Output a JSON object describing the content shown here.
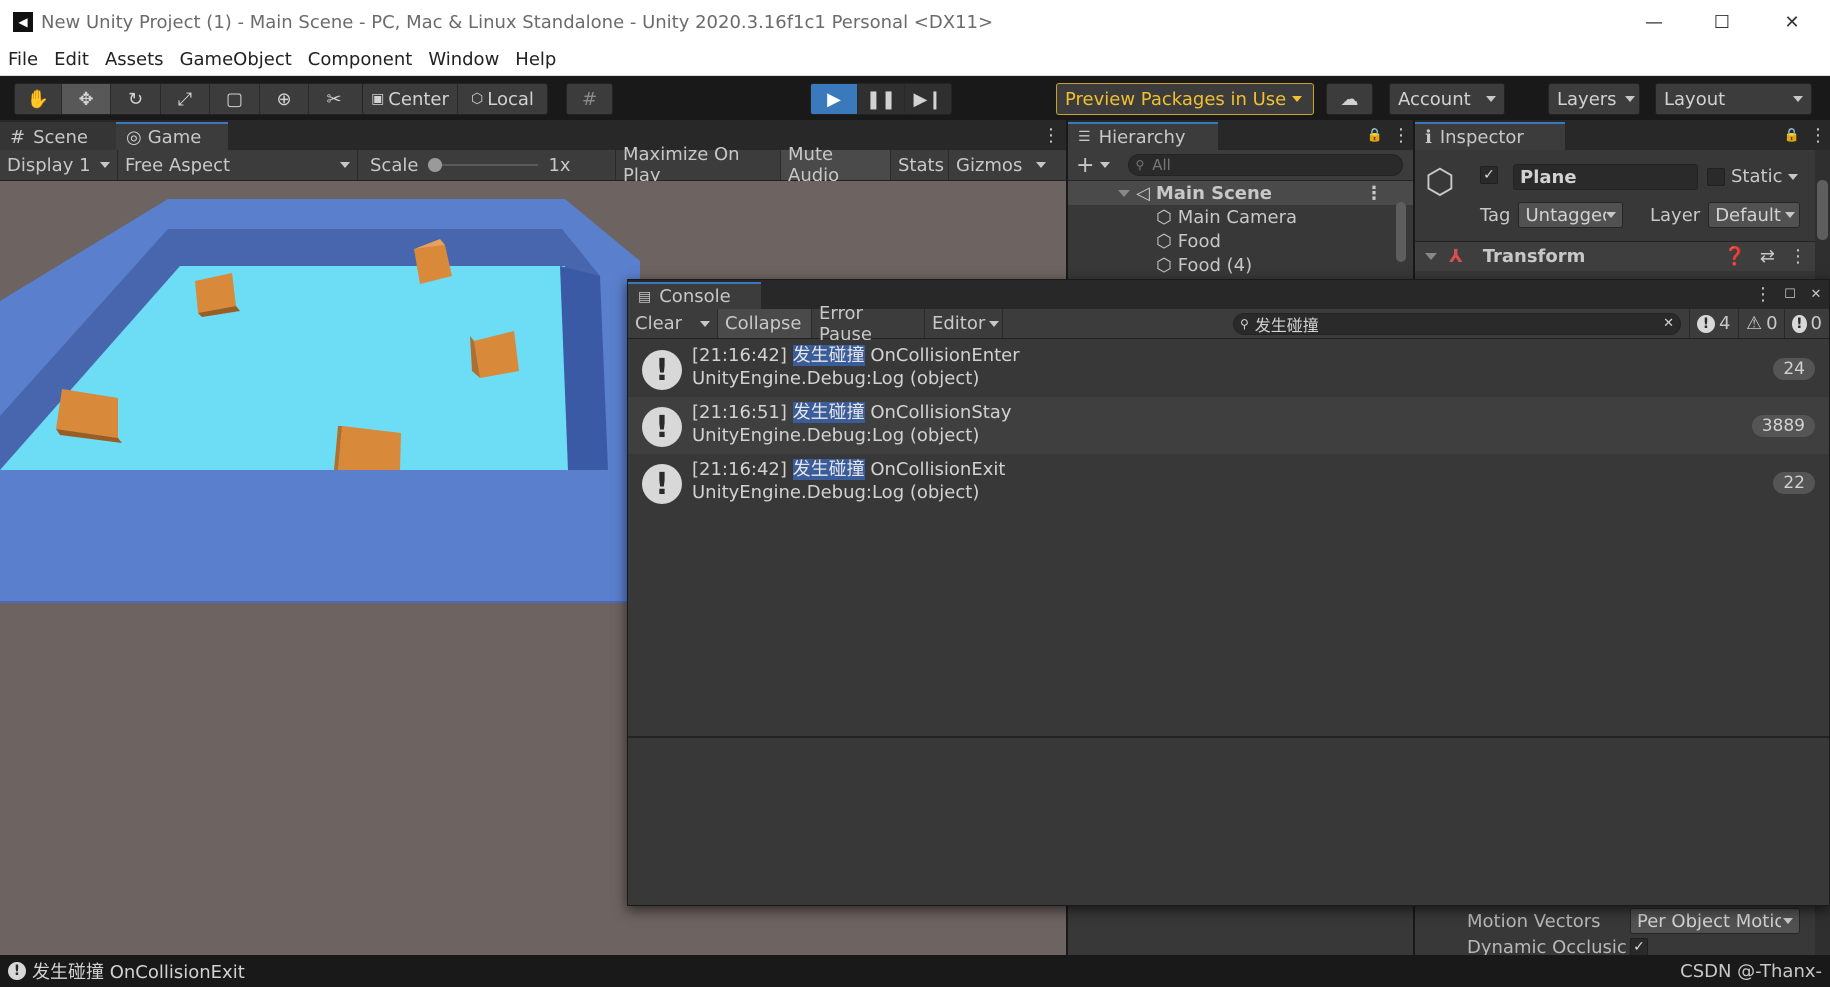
{
  "window": {
    "title": "New Unity Project (1) - Main Scene - PC, Mac & Linux Standalone - Unity 2020.3.16f1c1 Personal <DX11>"
  },
  "menu": [
    "File",
    "Edit",
    "Assets",
    "GameObject",
    "Component",
    "Window",
    "Help"
  ],
  "toolbar": {
    "pivot": "Center",
    "space": "Local",
    "preview_packages": "Preview Packages in Use",
    "account": "Account",
    "layers": "Layers",
    "layout": "Layout",
    "accent": "#3a79bb",
    "preview_color": "#f0c030"
  },
  "game_panel": {
    "tabs": [
      "Scene",
      "Game"
    ],
    "display": "Display 1",
    "aspect": "Free Aspect",
    "scale_label": "Scale",
    "scale_value": "1x",
    "maximize": "Maximize On Play",
    "mute": "Mute Audio",
    "stats": "Stats",
    "gizmos": "Gizmos",
    "scene_colors": {
      "wall": "#5a7fcc",
      "floor": "#6ddcf5",
      "cube": "#d8893a",
      "background": "#6d6360"
    }
  },
  "hierarchy": {
    "title": "Hierarchy",
    "search_placeholder": "All",
    "scene": "Main Scene",
    "items": [
      "Main Camera",
      "Food",
      "Food (4)"
    ]
  },
  "inspector": {
    "title": "Inspector",
    "object_name": "Plane",
    "static_label": "Static",
    "tag_label": "Tag",
    "tag_value": "Untagged",
    "layer_label": "Layer",
    "layer_value": "Default",
    "component": "Transform",
    "motion_vectors_label": "Motion Vectors",
    "motion_vectors_value": "Per Object Motio",
    "dynamic_occlusion_label": "Dynamic Occlusic"
  },
  "console": {
    "title": "Console",
    "clear": "Clear",
    "collapse": "Collapse",
    "error_pause": "Error Pause",
    "editor": "Editor",
    "search_value": "发生碰撞",
    "counts": {
      "info": "4",
      "warn": "0",
      "error": "0"
    },
    "logs": [
      {
        "time": "[21:16:42]",
        "keyword": "发生碰撞",
        "message": "OnCollisionEnter",
        "stack": "UnityEngine.Debug:Log (object)",
        "count": "24"
      },
      {
        "time": "[21:16:51]",
        "keyword": "发生碰撞",
        "message": "OnCollisionStay",
        "stack": "UnityEngine.Debug:Log (object)",
        "count": "3889"
      },
      {
        "time": "[21:16:42]",
        "keyword": "发生碰撞",
        "message": "OnCollisionExit",
        "stack": "UnityEngine.Debug:Log (object)",
        "count": "22"
      }
    ]
  },
  "status": {
    "message": "发生碰撞 OnCollisionExit",
    "watermark": "CSDN @-Thanx-"
  }
}
